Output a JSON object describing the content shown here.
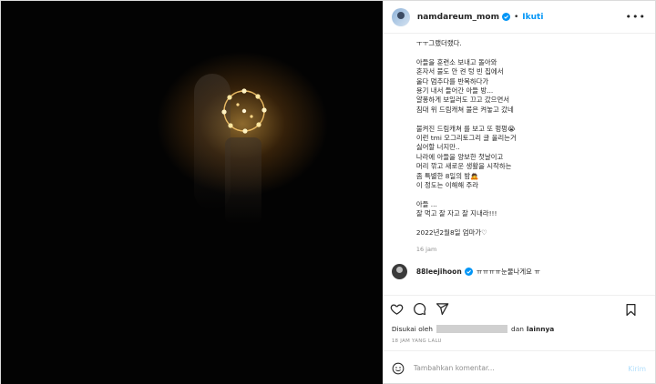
{
  "header": {
    "username": "namdareum_mom",
    "separator": "•",
    "follow_label": "Ikuti",
    "more_icon": "more-horizontal-icon"
  },
  "caption": {
    "text": "ㅜㅜ그랬더랬다.\n\n아들을 훈련소 보내고 돌아와\n혼자서 불도 안 켠 텅 빈 집에서\n울다 멈추다를 반복하다가\n용기 내서 들어간 아들 방...\n얄퐁하게 보일러도 끄고 갔으면서\n침대 위 드림캐쳐 불은 켜놓고 갔네\n\n불켜진 드림캐쳐 를 보고 또 펑펑😭\n이런 tmi 오그리토그리 글 올리는거\n싫어할 너지만..\n나라에 아들을 양보한 첫날이고\n머리 깎고 새로운 생활을 시작하는\n좀 특별한 8일의 밤🙇\n이 정도는 이해해 주라\n\n아들 ...\n잘 먹고 잘 자고 잘 지내라!!!\n\n2022년2월8일 엄마가♡",
    "time": "16 jam"
  },
  "comment": {
    "username": "88leejihoon",
    "text": "ㅠㅠㅠㅠ눈물나게요 ㅠ"
  },
  "likes": {
    "prefix": "Disukai oleh",
    "suffix": "dan",
    "others": "lainnya"
  },
  "timestamp": "18 JAM YANG LALU",
  "add_comment": {
    "placeholder": "Tambahkan komentar...",
    "post_label": "Kirim"
  },
  "colors": {
    "accent": "#0095f6",
    "post_disabled": "#b2dffc",
    "media_bg": "#030303"
  }
}
